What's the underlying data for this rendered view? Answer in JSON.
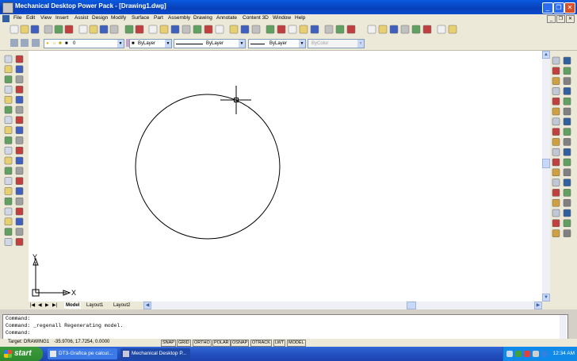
{
  "window": {
    "title": "Mechanical Desktop Power Pack - [Drawing1.dwg]",
    "minimize_glyph": "_",
    "restore_glyph": "❐",
    "close_glyph": "✕"
  },
  "menu": {
    "items": [
      "File",
      "Edit",
      "View",
      "Insert",
      "Assist",
      "Design",
      "Modify",
      "Surface",
      "Part",
      "Assembly",
      "Drawing",
      "Annotate",
      "Content 3D",
      "Window",
      "Help"
    ],
    "doc_minimize": "_",
    "doc_restore": "❐",
    "doc_close": "✕"
  },
  "layers": {
    "current_layer": "0",
    "color": "ByLayer",
    "linetype": "ByLayer",
    "lineweight": "ByLayer",
    "plotstyle": "ByColor"
  },
  "layout_tabs": [
    "Model",
    "Layout1",
    "Layout2"
  ],
  "active_tab": "Model",
  "ucs": {
    "x_label": "X",
    "y_label": "Y"
  },
  "command": {
    "lines": [
      "Command:",
      "Command: _regenall Regenerating model.",
      "Command:"
    ]
  },
  "status": {
    "target": "Target: DRAWING1",
    "coords": "-35.9706, 17.7254, 0.0000",
    "toggles": [
      "SNAP",
      "GRID",
      "ORTHO",
      "POLAR",
      "OSNAP",
      "OTRACK",
      "LWT",
      "MODEL"
    ]
  },
  "taskbar": {
    "start_label": "start",
    "buttons": [
      {
        "label": "DT3-Grafica pe calcul..."
      },
      {
        "label": "Mechanical Desktop P..."
      }
    ],
    "clock": "12:34 AM"
  },
  "colors": {
    "titlebar": "#0a4ad0",
    "taskbar": "#245ac8",
    "start_button": "#3c9b3c",
    "canvas": "#ffffff"
  }
}
